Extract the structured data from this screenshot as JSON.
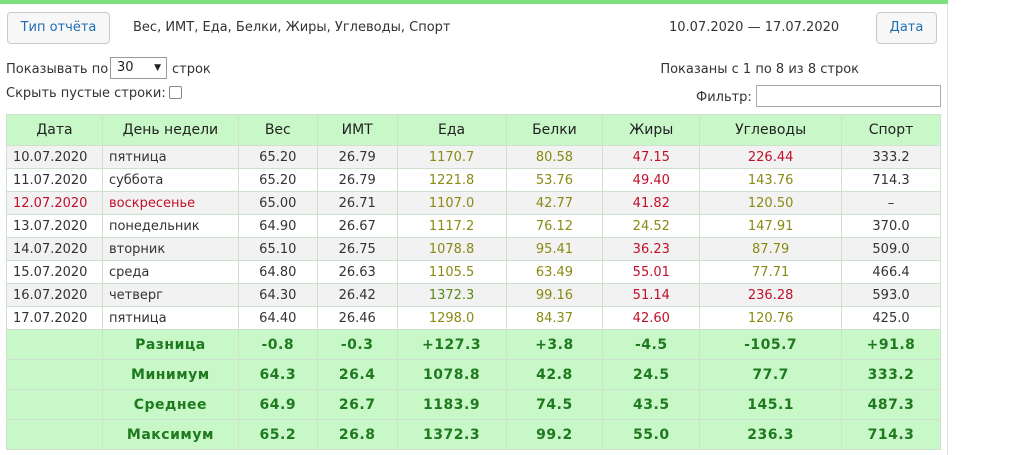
{
  "header": {
    "report_button": "Тип отчёта",
    "title": "Вес, ИМТ, Еда, Белки, Жиры, Углеводы, Спорт",
    "date_range": "10.07.2020 — 17.07.2020",
    "date_button": "Дата"
  },
  "controls": {
    "show_label": "Показывать по",
    "page_size": "30",
    "rows_label": "строк",
    "shown_info": "Показаны с 1 по 8 из 8 строк",
    "hide_empty_label": "Скрыть пустые строки:",
    "filter_label": "Фильтр:"
  },
  "colors": {
    "header_bg": "#c8f7c8",
    "green": "#5a8a14",
    "olive": "#8a8a14",
    "red": "#c0102a"
  },
  "table": {
    "columns": [
      "Дата",
      "День недели",
      "Вес",
      "ИМТ",
      "Еда",
      "Белки",
      "Жиры",
      "Углеводы",
      "Спорт"
    ],
    "rows": [
      {
        "date": "10.07.2020",
        "day": "пятница",
        "weight": "65.20",
        "bmi": "26.79",
        "food": "1170.7",
        "protein": "80.58",
        "fat": "47.15",
        "carbs": "226.44",
        "sport": "333.2"
      },
      {
        "date": "11.07.2020",
        "day": "суббота",
        "weight": "65.20",
        "bmi": "26.79",
        "food": "1221.8",
        "protein": "53.76",
        "fat": "49.40",
        "carbs": "143.76",
        "sport": "714.3"
      },
      {
        "date": "12.07.2020",
        "day": "воскресенье",
        "weight": "65.00",
        "bmi": "26.71",
        "food": "1107.0",
        "protein": "42.77",
        "fat": "41.82",
        "carbs": "120.50",
        "sport": "–"
      },
      {
        "date": "13.07.2020",
        "day": "понедельник",
        "weight": "64.90",
        "bmi": "26.67",
        "food": "1117.2",
        "protein": "76.12",
        "fat": "24.52",
        "carbs": "147.91",
        "sport": "370.0"
      },
      {
        "date": "14.07.2020",
        "day": "вторник",
        "weight": "65.10",
        "bmi": "26.75",
        "food": "1078.8",
        "protein": "95.41",
        "fat": "36.23",
        "carbs": "87.79",
        "sport": "509.0"
      },
      {
        "date": "15.07.2020",
        "day": "среда",
        "weight": "64.80",
        "bmi": "26.63",
        "food": "1105.5",
        "protein": "63.49",
        "fat": "55.01",
        "carbs": "77.71",
        "sport": "466.4"
      },
      {
        "date": "16.07.2020",
        "day": "четверг",
        "weight": "64.30",
        "bmi": "26.42",
        "food": "1372.3",
        "protein": "99.16",
        "fat": "51.14",
        "carbs": "236.28",
        "sport": "593.0"
      },
      {
        "date": "17.07.2020",
        "day": "пятница",
        "weight": "64.40",
        "bmi": "26.46",
        "food": "1298.0",
        "protein": "84.37",
        "fat": "42.60",
        "carbs": "120.76",
        "sport": "425.0"
      }
    ],
    "summary": [
      {
        "label": "Разница",
        "weight": "-0.8",
        "bmi": "-0.3",
        "food": "+127.3",
        "protein": "+3.8",
        "fat": "-4.5",
        "carbs": "-105.7",
        "sport": "+91.8"
      },
      {
        "label": "Минимум",
        "weight": "64.3",
        "bmi": "26.4",
        "food": "1078.8",
        "protein": "42.8",
        "fat": "24.5",
        "carbs": "77.7",
        "sport": "333.2"
      },
      {
        "label": "Среднее",
        "weight": "64.9",
        "bmi": "26.7",
        "food": "1183.9",
        "protein": "74.5",
        "fat": "43.5",
        "carbs": "145.1",
        "sport": "487.3"
      },
      {
        "label": "Максимум",
        "weight": "65.2",
        "bmi": "26.8",
        "food": "1372.3",
        "protein": "99.2",
        "fat": "55.0",
        "carbs": "236.3",
        "sport": "714.3"
      }
    ]
  }
}
